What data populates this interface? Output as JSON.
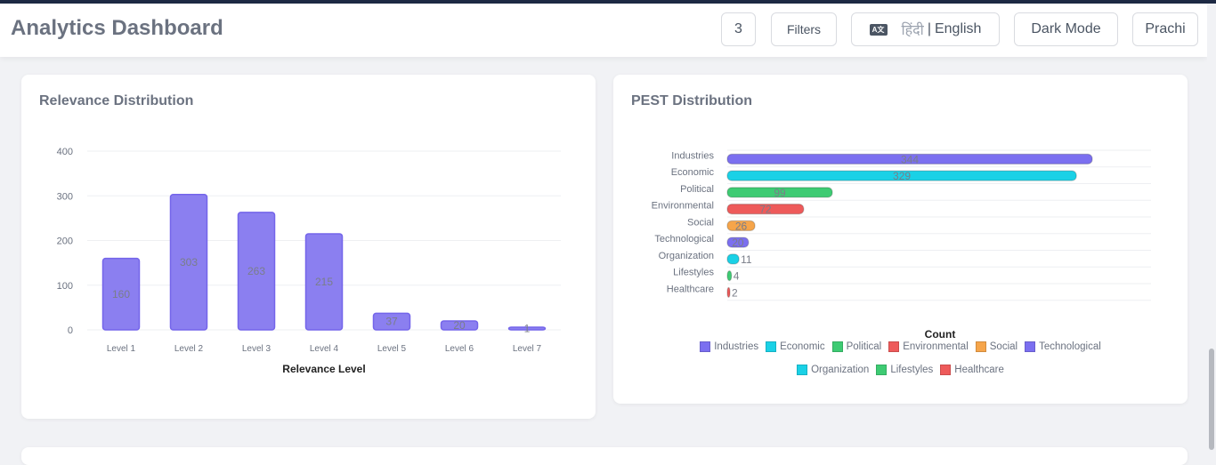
{
  "header": {
    "title": "Analytics Dashboard",
    "count_badge": "3",
    "filters_label": "Filters",
    "lang_icon": "language-icon",
    "lang_hindi": "हिंदी",
    "lang_separator": "|",
    "lang_english": "English",
    "dark_mode_label": "Dark Mode",
    "user_label": "Prachi"
  },
  "relevance": {
    "title": "Relevance Distribution",
    "chart_data": {
      "type": "bar",
      "categories": [
        "Level 1",
        "Level 2",
        "Level 3",
        "Level 4",
        "Level 5",
        "Level 6",
        "Level 7"
      ],
      "values": [
        160,
        303,
        263,
        215,
        37,
        20,
        1
      ],
      "value_labels": [
        "160",
        "303",
        "263",
        "215",
        "37",
        "20",
        "1"
      ],
      "xlabel": "Relevance Level",
      "ylabel": "",
      "yticks": [
        "0",
        "100",
        "200",
        "300",
        "400"
      ],
      "ylim": [
        0,
        400
      ],
      "color": "#8b7ff0",
      "grid": true
    }
  },
  "pest": {
    "title": "PEST Distribution",
    "chart_data": {
      "type": "bar",
      "orientation": "horizontal",
      "categories": [
        "Industries",
        "Economic",
        "Political",
        "Environmental",
        "Social",
        "Technological",
        "Organization",
        "Lifestyles",
        "Healthcare"
      ],
      "values": [
        344,
        329,
        99,
        72,
        26,
        20,
        11,
        4,
        2
      ],
      "value_labels": [
        "344",
        "329",
        "99",
        "72",
        "26",
        "20",
        "11",
        "4",
        "2"
      ],
      "colors": [
        "#7b6ff0",
        "#1ad1e6",
        "#3ecb73",
        "#ee5a5a",
        "#f6a54a",
        "#7b6ff0",
        "#1ad1e6",
        "#3ecb73",
        "#ee5a5a"
      ],
      "xlabel": "Count",
      "xlim": [
        0,
        344
      ],
      "legend_position": "bottom",
      "grid": true
    }
  }
}
